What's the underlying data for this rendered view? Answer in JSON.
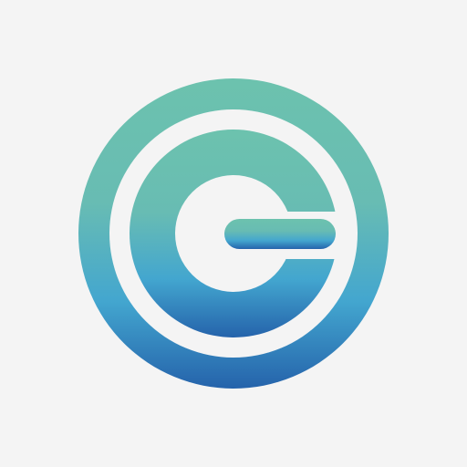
{
  "logo": {
    "icon": "power-c-logo-icon",
    "colors": {
      "background": "#f4f4f4",
      "gradient_top": "#6cc2ae",
      "gradient_mid": "#43a6cf",
      "gradient_bottom": "#2563ab",
      "cutout": "#f4f4f4"
    }
  }
}
